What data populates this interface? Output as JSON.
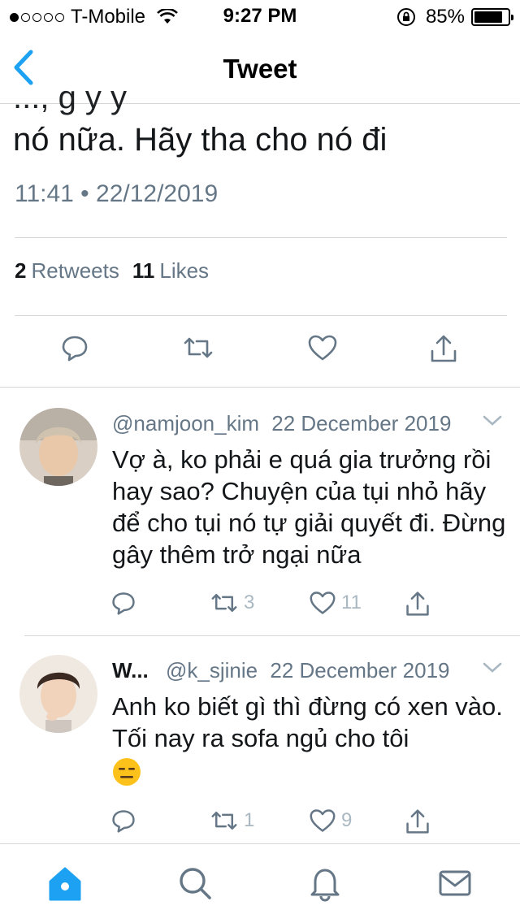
{
  "status_bar": {
    "carrier": "T-Mobile",
    "time": "9:27 PM",
    "battery": "85%",
    "battery_level": 0.85,
    "signal_bars": 1
  },
  "nav": {
    "title": "Tweet",
    "back_icon": "chevron-left-icon"
  },
  "tweet": {
    "text_cut": "...,   g   y              y",
    "text_visible": "nó nữa. Hãy tha cho nó đi",
    "timestamp": "11:41 • 22/12/2019",
    "retweets_count": "2",
    "retweets_label": "Retweets",
    "likes_count": "11",
    "likes_label": "Likes",
    "actions": [
      "reply-icon",
      "retweet-icon",
      "like-icon",
      "share-icon"
    ]
  },
  "replies": [
    {
      "name": "",
      "handle": "@namjoon_kim",
      "date": "22 December 2019",
      "text": "Vợ à, ko phải e quá gia trưởng rồi hay sao? Chuyện của tụi nhỏ hãy để cho tụi nó tự giải quyết đi. Đừng gây thêm trở ngại nữa",
      "retweets": "3",
      "likes": "11"
    },
    {
      "name": "W...",
      "handle": "@k_sjinie",
      "date": "22 December 2019",
      "text": "Anh ko biết gì thì đừng có xen vào. Tối nay ra sofa ngủ cho tôi",
      "emoji": "expressionless-face-emoji",
      "retweets": "1",
      "likes": "9"
    }
  ],
  "tab_bar": {
    "items": [
      "home-icon",
      "search-icon",
      "notifications-icon",
      "messages-icon"
    ],
    "active": "home-icon"
  },
  "colors": {
    "accent": "#1da1f2",
    "secondary_text": "#657786",
    "icon_gray": "#657786",
    "divider": "#d6d6d6"
  }
}
